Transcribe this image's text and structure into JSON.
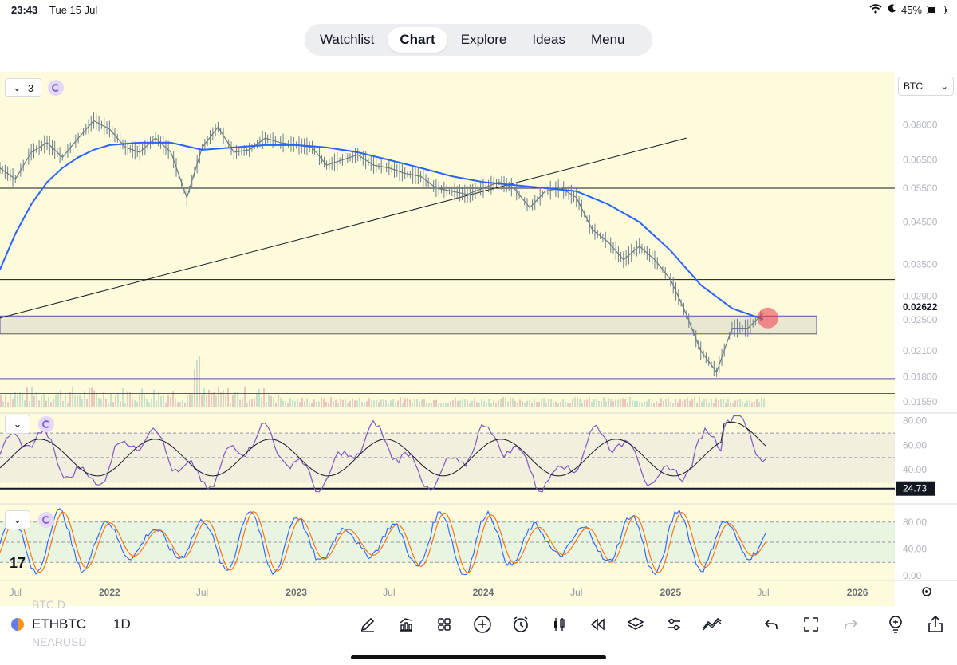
{
  "status": {
    "time": "23:43",
    "date": "Tue 15 Jul",
    "battery": "45%"
  },
  "nav": {
    "tabs": [
      "Watchlist",
      "Chart",
      "Explore",
      "Ideas",
      "Menu"
    ],
    "active": "Chart"
  },
  "pane_controls": {
    "collapse_count": "3",
    "symbol_select": "BTC"
  },
  "colors": {
    "background": "#fdfbdc",
    "ma_line": "#2962ff",
    "price_wick": "#6b7d8a",
    "rsi": "#7e57c2",
    "stoch_k": "#2962ff",
    "stoch_d": "#ff6d00",
    "marker": "#f23645"
  },
  "chart_data": [
    {
      "type": "line",
      "pane": "price",
      "symbol": "ETHBTC",
      "interval": "1D",
      "scale": "log",
      "y_ticks": [
        0.08,
        0.065,
        0.055,
        0.045,
        0.035,
        0.029,
        0.021,
        0.018,
        0.0155
      ],
      "y_tick_labels": [
        "0.08000",
        "0.06500",
        "0.05500",
        "0.04500",
        "0.03500",
        "0.02900",
        "0.02100",
        "0.01800",
        "0.01550"
      ],
      "last_price_label": "0.02622",
      "last_price_sub_label": "0.02500",
      "x_tick_labels": [
        "Jul",
        "2022",
        "Jul",
        "2023",
        "Jul",
        "2024",
        "Jul",
        "2025",
        "Jul",
        "2026"
      ],
      "x_range": [
        "2021-06-01",
        "2026-03-15"
      ],
      "ylim": [
        0.0148,
        0.089
      ],
      "price": [
        [
          "2021-06-01",
          0.062
        ],
        [
          "2021-07-01",
          0.058
        ],
        [
          "2021-08-01",
          0.068
        ],
        [
          "2021-09-01",
          0.072
        ],
        [
          "2021-10-01",
          0.066
        ],
        [
          "2021-11-01",
          0.074
        ],
        [
          "2021-12-01",
          0.082
        ],
        [
          "2022-01-01",
          0.078
        ],
        [
          "2022-02-01",
          0.07
        ],
        [
          "2022-03-01",
          0.068
        ],
        [
          "2022-04-01",
          0.074
        ],
        [
          "2022-05-01",
          0.068
        ],
        [
          "2022-06-01",
          0.052
        ],
        [
          "2022-07-01",
          0.07
        ],
        [
          "2022-08-01",
          0.079
        ],
        [
          "2022-09-01",
          0.068
        ],
        [
          "2022-10-01",
          0.069
        ],
        [
          "2022-11-01",
          0.074
        ],
        [
          "2022-12-01",
          0.072
        ],
        [
          "2023-01-01",
          0.071
        ],
        [
          "2023-02-01",
          0.07
        ],
        [
          "2023-03-01",
          0.063
        ],
        [
          "2023-04-01",
          0.065
        ],
        [
          "2023-05-01",
          0.067
        ],
        [
          "2023-06-01",
          0.063
        ],
        [
          "2023-07-01",
          0.062
        ],
        [
          "2023-08-01",
          0.06
        ],
        [
          "2023-09-01",
          0.059
        ],
        [
          "2023-10-01",
          0.055
        ],
        [
          "2023-11-01",
          0.054
        ],
        [
          "2023-12-01",
          0.053
        ],
        [
          "2024-01-01",
          0.055
        ],
        [
          "2024-02-01",
          0.057
        ],
        [
          "2024-03-01",
          0.055
        ],
        [
          "2024-04-01",
          0.049
        ],
        [
          "2024-05-01",
          0.054
        ],
        [
          "2024-06-01",
          0.055
        ],
        [
          "2024-07-01",
          0.052
        ],
        [
          "2024-08-01",
          0.043
        ],
        [
          "2024-09-01",
          0.04
        ],
        [
          "2024-10-01",
          0.036
        ],
        [
          "2024-11-01",
          0.039
        ],
        [
          "2024-12-01",
          0.036
        ],
        [
          "2025-01-01",
          0.032
        ],
        [
          "2025-02-01",
          0.026
        ],
        [
          "2025-03-01",
          0.021
        ],
        [
          "2025-04-01",
          0.0185
        ],
        [
          "2025-05-01",
          0.024
        ],
        [
          "2025-06-01",
          0.024
        ],
        [
          "2025-07-01",
          0.0262
        ]
      ],
      "moving_average": [
        [
          "2021-06-01",
          0.034
        ],
        [
          "2021-07-01",
          0.042
        ],
        [
          "2021-08-01",
          0.05
        ],
        [
          "2021-09-01",
          0.057
        ],
        [
          "2021-10-01",
          0.062
        ],
        [
          "2021-11-01",
          0.066
        ],
        [
          "2021-12-01",
          0.069
        ],
        [
          "2022-01-01",
          0.071
        ],
        [
          "2022-03-01",
          0.072
        ],
        [
          "2022-05-01",
          0.072
        ],
        [
          "2022-07-01",
          0.069
        ],
        [
          "2022-09-01",
          0.07
        ],
        [
          "2022-11-01",
          0.071
        ],
        [
          "2023-01-01",
          0.071
        ],
        [
          "2023-03-01",
          0.07
        ],
        [
          "2023-05-01",
          0.068
        ],
        [
          "2023-07-01",
          0.065
        ],
        [
          "2023-09-01",
          0.062
        ],
        [
          "2023-11-01",
          0.059
        ],
        [
          "2024-01-01",
          0.057
        ],
        [
          "2024-03-01",
          0.056
        ],
        [
          "2024-05-01",
          0.055
        ],
        [
          "2024-07-01",
          0.054
        ],
        [
          "2024-09-01",
          0.05
        ],
        [
          "2024-11-01",
          0.045
        ],
        [
          "2025-01-01",
          0.038
        ],
        [
          "2025-03-01",
          0.031
        ],
        [
          "2025-05-01",
          0.027
        ],
        [
          "2025-07-01",
          0.0253
        ]
      ],
      "horizontal_levels": [
        0.055,
        0.032,
        0.0178,
        0.0163
      ],
      "zone": [
        0.0232,
        0.0258
      ],
      "trendline": [
        [
          "2021-06-01",
          0.0255
        ],
        [
          "2025-02-01",
          0.074
        ]
      ],
      "marker": [
        "2025-07-10",
        0.0255
      ]
    },
    {
      "type": "line",
      "pane": "rsi",
      "y_tick_labels": [
        "80.00",
        "60.00",
        "40.00"
      ],
      "value_label": "24.73",
      "levels": [
        70,
        50,
        30
      ]
    },
    {
      "type": "line",
      "pane": "stochastic",
      "y_tick_labels": [
        "80.00",
        "40.00",
        "0.00"
      ],
      "levels": [
        80,
        50,
        20
      ]
    }
  ],
  "bottom_bar": {
    "symbol": "ETHBTC",
    "interval": "1D",
    "ghost_above": "BTC.D",
    "ghost_below": "NEARUSD",
    "tools": [
      "pen-icon",
      "indicators-icon",
      "layouts-icon",
      "add-icon",
      "alert-icon",
      "candles-icon",
      "replay-icon",
      "layers-icon",
      "settings-sliders-icon",
      "compare-icon",
      "undo-icon",
      "fullscreen-icon",
      "redo-icon",
      "lightbulb-icon",
      "share-icon"
    ]
  }
}
